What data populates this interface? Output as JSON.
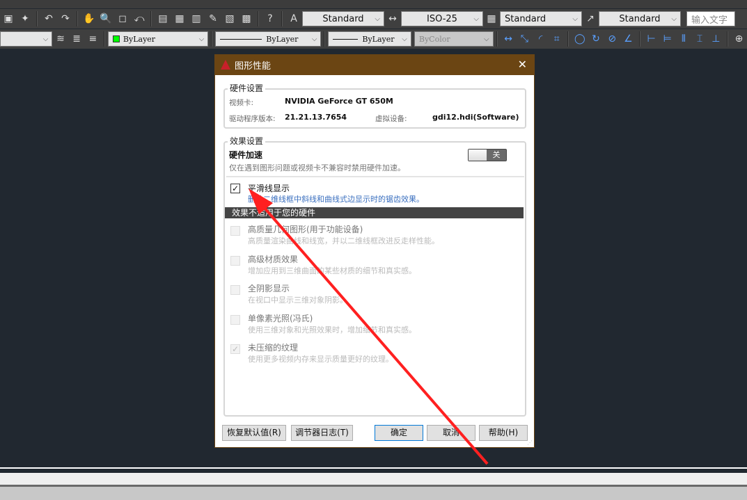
{
  "toolbar": {
    "row1": {
      "text_style": "Standard",
      "dim_style": "ISO-25",
      "table_style": "Standard",
      "mleader_style": "Standard",
      "search_placeholder": "输入文字"
    },
    "row2": {
      "color": "ByLayer",
      "color_swatch": "#00ff00",
      "linetype": "ByLayer",
      "lineweight": "ByLayer",
      "plot_style": "ByColor"
    }
  },
  "dialog": {
    "title": "图形性能",
    "close": "✕",
    "hardware": {
      "legend": "硬件设置",
      "video_card_label": "视频卡:",
      "video_card": "NVIDIA GeForce GT 650M",
      "driver_label": "驱动程序版本:",
      "driver": "21.21.13.7654",
      "virtual_label": "虚拟设备:",
      "virtual": "gdi12.hdi(Software)"
    },
    "effects": {
      "legend": "效果设置",
      "hw_accel_title": "硬件加速",
      "hw_accel_desc": "仅在遇到图形问题或视频卡不兼容时禁用硬件加速。",
      "toggle_label": "关",
      "toggle_on": false,
      "smooth": {
        "title": "平滑线显示",
        "desc": "删除二维线框中斜线和曲线式边显示时的锯齿效果。",
        "checked": true
      },
      "unsupported_header": "效果不适用于您的硬件",
      "items": [
        {
          "title": "高质量几何图形(用于功能设备)",
          "desc": "高质量渲染曲线和线宽，并以二维线框改进反走样性能。",
          "checked": false
        },
        {
          "title": "高级材质效果",
          "desc": "增加应用到三维曲面的某些材质的细节和真实感。",
          "checked": false
        },
        {
          "title": "全阴影显示",
          "desc": "在视口中显示三维对象阴影。",
          "checked": false
        },
        {
          "title": "单像素光照(冯氏)",
          "desc": "使用三维对象和光照效果时，增加细节和真实感。",
          "checked": false
        },
        {
          "title": "未压缩的纹理",
          "desc": "使用更多视频内存来显示质量更好的纹理。",
          "checked": true
        }
      ]
    },
    "buttons": {
      "restore": "恢复默认值(R)",
      "tuner_log": "调节器日志(T)",
      "ok": "确定",
      "cancel": "取消",
      "help": "帮助(H)"
    }
  },
  "annotation": {
    "arrow_color": "#ff2020"
  }
}
